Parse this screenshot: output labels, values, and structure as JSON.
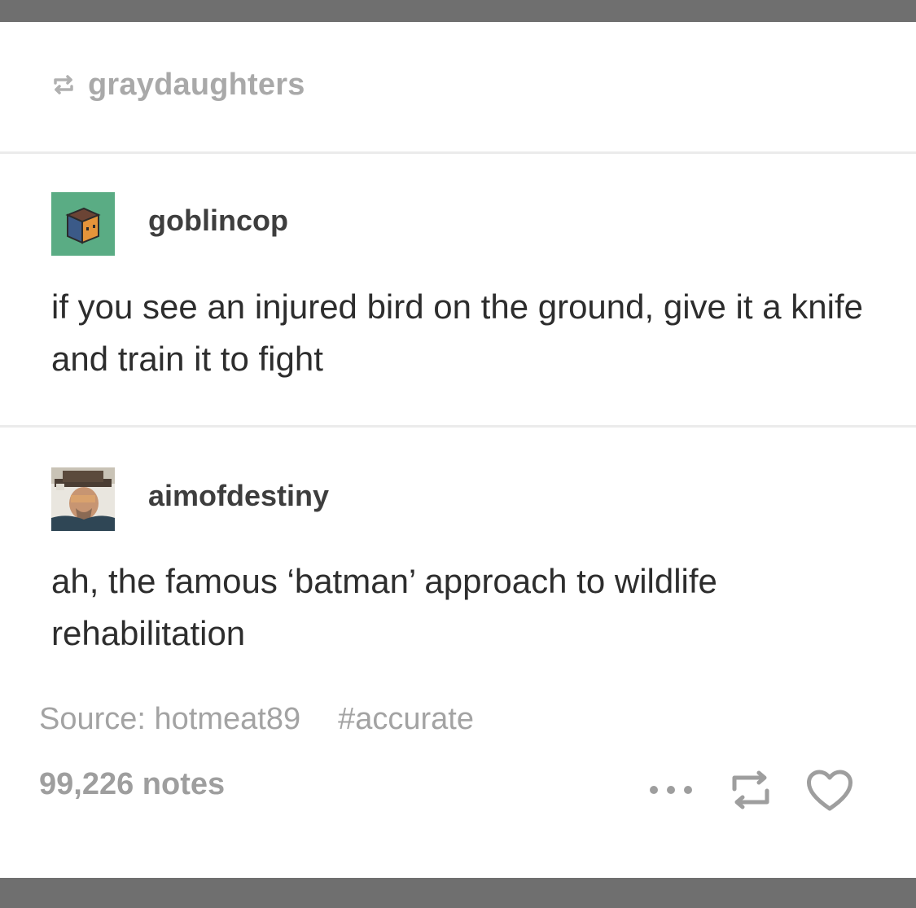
{
  "reblog_header": {
    "username": "graydaughters",
    "icon": "reblog-icon"
  },
  "posts": [
    {
      "username": "goblincop",
      "avatar": "cube-avatar",
      "text": "if you see an injured bird on the ground, give it a knife and train it to fight"
    },
    {
      "username": "aimofdestiny",
      "avatar": "photo-avatar",
      "text": "ah, the famous ‘batman’ approach to wildlife rehabilitation"
    }
  ],
  "footer": {
    "source": "Source: hotmeat89",
    "tag": "#accurate",
    "notes": "99,226 notes",
    "actions": [
      "more-options-icon",
      "reblog-icon",
      "heart-icon"
    ]
  },
  "colors": {
    "frame": "#6f6f6f",
    "divider": "#ebebeb",
    "cube_bg": "#5aac84",
    "cube_blue": "#3b5a88",
    "cube_orange": "#e4943a",
    "muted_text": "#a3a3a3",
    "body_text": "#2d2d2d"
  }
}
